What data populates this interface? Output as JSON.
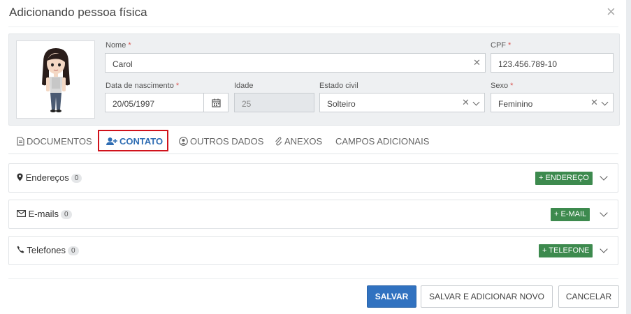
{
  "dialog": {
    "title": "Adicionando pessoa física",
    "close_symbol": "×"
  },
  "person": {
    "nome": {
      "label": "Nome",
      "required_mark": "*",
      "value": "Carol"
    },
    "cpf": {
      "label": "CPF",
      "required_mark": "*",
      "value": "123.456.789-10"
    },
    "data_nascimento": {
      "label": "Data de nascimento",
      "required_mark": "*",
      "value": "20/05/1997"
    },
    "idade": {
      "label": "Idade",
      "value": "25"
    },
    "estado_civil": {
      "label": "Estado civil",
      "value": "Solteiro"
    },
    "sexo": {
      "label": "Sexo",
      "required_mark": "*",
      "value": "Feminino"
    }
  },
  "tabs": [
    {
      "label": "DOCUMENTOS",
      "icon": "document-icon"
    },
    {
      "label": "CONTATO",
      "icon": "user-plus-icon",
      "active": true
    },
    {
      "label": "OUTROS DADOS",
      "icon": "user-circle-icon"
    },
    {
      "label": "ANEXOS",
      "icon": "paperclip-icon"
    },
    {
      "label": "CAMPOS ADICIONAIS"
    }
  ],
  "sections": [
    {
      "label": "Endereços",
      "count": "0",
      "icon": "map-marker-icon",
      "button": "+ ENDEREÇO"
    },
    {
      "label": "E-mails",
      "count": "0",
      "icon": "envelope-icon",
      "button": "+ E-MAIL"
    },
    {
      "label": "Telefones",
      "count": "0",
      "icon": "phone-icon",
      "button": "+ TELEFONE"
    }
  ],
  "footer": {
    "save": "SALVAR",
    "save_new": "SALVAR E ADICIONAR NOVO",
    "cancel": "CANCELAR"
  },
  "colors": {
    "primary": "#3172c0",
    "success": "#3d8a4e",
    "tab_highlight": "#d0121b",
    "active_tab": "#2f6db3"
  }
}
